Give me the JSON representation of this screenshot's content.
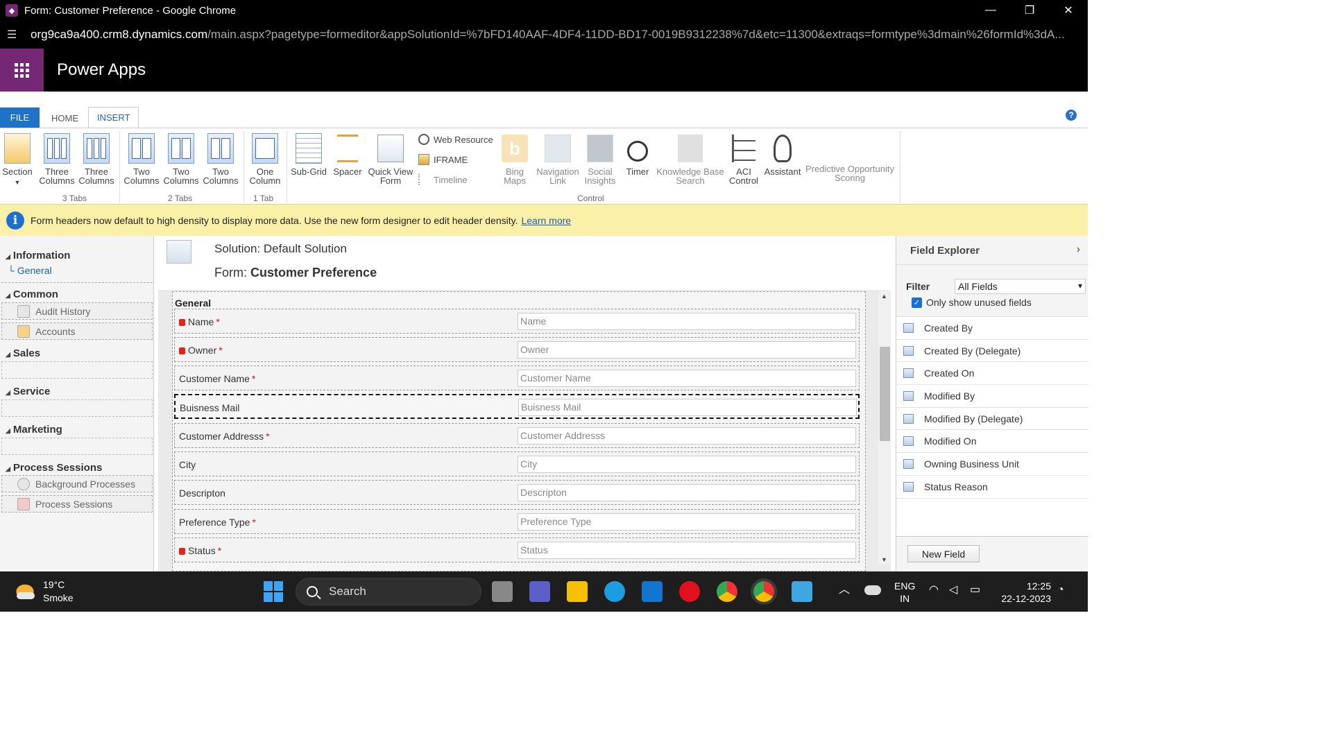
{
  "browser": {
    "window_title": "Form: Customer Preference - Google Chrome",
    "url_host": "org9ca9a400.crm8.dynamics.com",
    "url_path": "/main.aspx?pagetype=formeditor&appSolutionId=%7bFD140AAF-4DF4-11DD-BD17-0019B9312238%7d&etc=11300&extraqs=formtype%3dmain%26formId%3dA..."
  },
  "app": {
    "title": "Power Apps"
  },
  "ribbon": {
    "tabs": [
      "FILE",
      "HOME",
      "INSERT"
    ],
    "buttons": {
      "section": "Section",
      "three_col_a": [
        "Three",
        "Columns"
      ],
      "three_col_b": [
        "Three",
        "Columns"
      ],
      "two_col_a": [
        "Two",
        "Columns"
      ],
      "two_col_b": [
        "Two",
        "Columns"
      ],
      "two_col_c": [
        "Two",
        "Columns"
      ],
      "one_col": [
        "One",
        "Column"
      ],
      "sub_grid": "Sub-Grid",
      "spacer": "Spacer",
      "quick_view": [
        "Quick View",
        "Form"
      ],
      "web_resource": "Web Resource",
      "iframe": "IFRAME",
      "timeline": "Timeline",
      "bing_maps": [
        "Bing",
        "Maps"
      ],
      "nav_link": [
        "Navigation",
        "Link"
      ],
      "social_insights": [
        "Social",
        "Insights"
      ],
      "timer": "Timer",
      "kb_search": [
        "Knowledge Base",
        "Search"
      ],
      "aci_control": [
        "ACI",
        "Control"
      ],
      "assistant": "Assistant",
      "predictive": [
        "Predictive Opportunity",
        "Scoring"
      ]
    },
    "groups": {
      "three_tabs": "3 Tabs",
      "two_tabs": "2 Tabs",
      "one_tab": "1 Tab",
      "control": "Control"
    }
  },
  "notification": {
    "message": "Form headers now default to high density to display more data. Use the new form designer to edit header density.",
    "link": "Learn more"
  },
  "leftnav": {
    "information": "Information",
    "general": "General",
    "common": "Common",
    "audit_history": "Audit History",
    "accounts": "Accounts",
    "sales": "Sales",
    "service": "Service",
    "marketing": "Marketing",
    "process_sessions_header": "Process Sessions",
    "background_processes": "Background Processes",
    "process_sessions": "Process Sessions"
  },
  "form": {
    "solution_label": "Solution: Default Solution",
    "form_prefix": "Form: ",
    "form_name": "Customer Preference",
    "section_label": "General",
    "fields": [
      {
        "label": "Name",
        "placeholder": "Name",
        "required": "*",
        "locked": true
      },
      {
        "label": "Owner",
        "placeholder": "Owner",
        "required": "*",
        "locked": true
      },
      {
        "label": "Customer Name",
        "placeholder": "Customer Name",
        "required": "*",
        "locked": false
      },
      {
        "label": "Buisness Mail",
        "placeholder": "Buisness Mail",
        "required": "",
        "locked": false,
        "selected": true
      },
      {
        "label": "Customer Addresss",
        "placeholder": "Customer Addresss",
        "required": "*",
        "locked": false
      },
      {
        "label": "City",
        "placeholder": "City",
        "required": "",
        "locked": false
      },
      {
        "label": "Descripton",
        "placeholder": "Descripton",
        "required": "",
        "locked": false
      },
      {
        "label": "Preference Type",
        "placeholder": "Preference Type",
        "required": "*",
        "locked": false
      },
      {
        "label": "Status",
        "placeholder": "Status",
        "required": "*",
        "locked": true
      }
    ]
  },
  "field_explorer": {
    "title": "Field Explorer",
    "filter_label": "Filter",
    "filter_value": "All Fields",
    "only_unused": "Only show unused fields",
    "fields": [
      "Created By",
      "Created By (Delegate)",
      "Created On",
      "Modified By",
      "Modified By (Delegate)",
      "Modified On",
      "Owning Business Unit",
      "Status Reason"
    ],
    "new_field": "New Field"
  },
  "taskbar": {
    "temperature": "19°C",
    "condition": "Smoke",
    "search": "Search",
    "lang": "ENG",
    "region": "IN",
    "time": "12:25",
    "date": "22-12-2023"
  }
}
